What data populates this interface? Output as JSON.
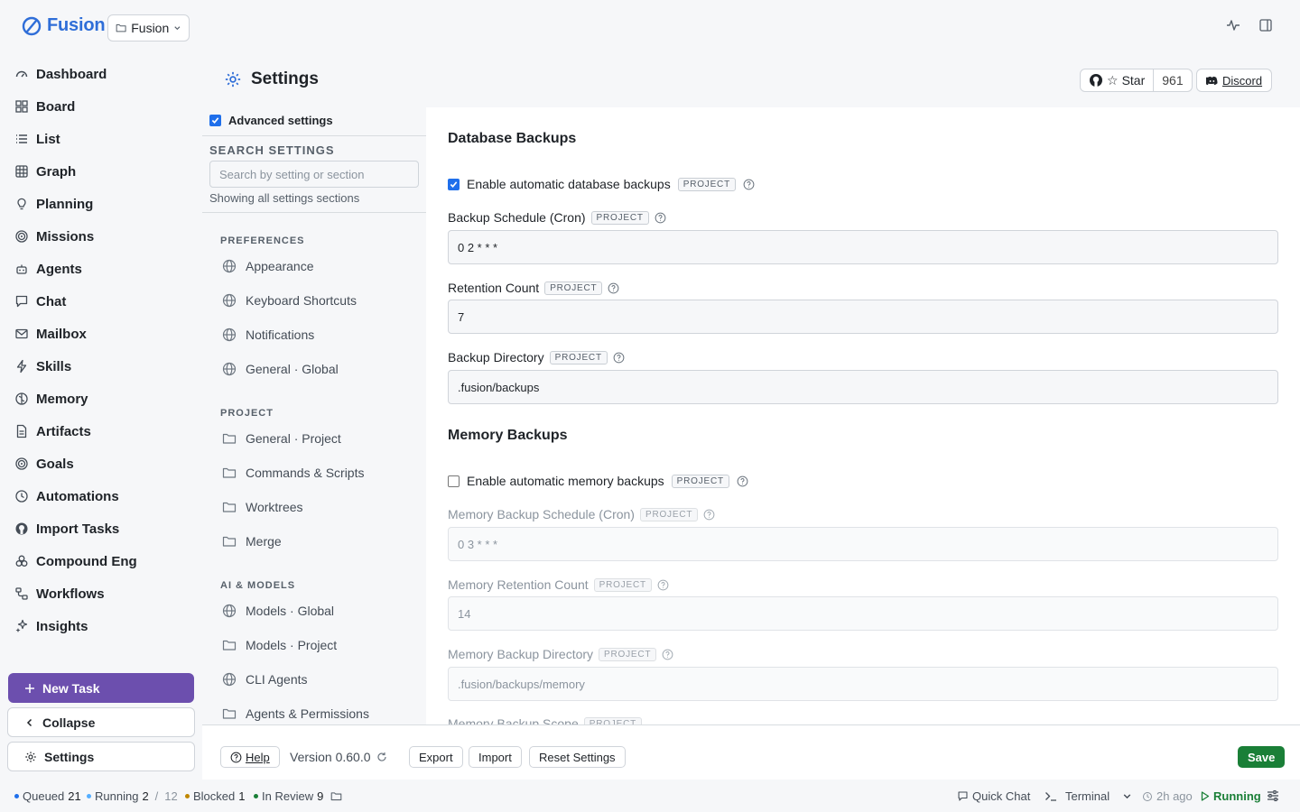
{
  "brand": {
    "name": "Fusion"
  },
  "project_switcher": {
    "label": "Fusion"
  },
  "sidebar": {
    "items": [
      {
        "label": "Dashboard",
        "icon": "gauge-icon"
      },
      {
        "label": "Board",
        "icon": "board-icon"
      },
      {
        "label": "List",
        "icon": "list-icon"
      },
      {
        "label": "Graph",
        "icon": "table-icon"
      },
      {
        "label": "Planning",
        "icon": "lightbulb-icon"
      },
      {
        "label": "Missions",
        "icon": "target-icon"
      },
      {
        "label": "Agents",
        "icon": "bot-icon"
      },
      {
        "label": "Chat",
        "icon": "chat-icon"
      },
      {
        "label": "Mailbox",
        "icon": "mail-icon"
      },
      {
        "label": "Skills",
        "icon": "bolt-icon"
      },
      {
        "label": "Memory",
        "icon": "brain-icon"
      },
      {
        "label": "Artifacts",
        "icon": "file-icon"
      },
      {
        "label": "Goals",
        "icon": "target-icon"
      },
      {
        "label": "Automations",
        "icon": "clock-icon"
      },
      {
        "label": "Import Tasks",
        "icon": "github-icon"
      },
      {
        "label": "Compound Eng",
        "icon": "compound-icon"
      },
      {
        "label": "Workflows",
        "icon": "workflow-icon"
      },
      {
        "label": "Insights",
        "icon": "sparkle-icon"
      }
    ],
    "new_task": "New Task",
    "collapse": "Collapse",
    "settings": "Settings"
  },
  "header": {
    "title": "Settings",
    "github_star": "Star",
    "github_count": "961",
    "discord": "Discord"
  },
  "settings_nav": {
    "advanced_label": "Advanced settings",
    "advanced_checked": true,
    "search_title": "SEARCH SETTINGS",
    "search_placeholder": "Search by setting or section",
    "showing": "Showing all settings sections",
    "sections": [
      {
        "title": "PREFERENCES",
        "items": [
          {
            "label": "Appearance",
            "icon": "globe-icon"
          },
          {
            "label": "Keyboard Shortcuts",
            "icon": "globe-icon"
          },
          {
            "label": "Notifications",
            "icon": "globe-icon"
          },
          {
            "label": "General · Global",
            "icon": "globe-icon"
          }
        ]
      },
      {
        "title": "PROJECT",
        "items": [
          {
            "label": "General · Project",
            "icon": "folder-icon"
          },
          {
            "label": "Commands & Scripts",
            "icon": "folder-icon"
          },
          {
            "label": "Worktrees",
            "icon": "folder-icon"
          },
          {
            "label": "Merge",
            "icon": "folder-icon"
          }
        ]
      },
      {
        "title": "AI & MODELS",
        "items": [
          {
            "label": "Models · Global",
            "icon": "globe-icon"
          },
          {
            "label": "Models · Project",
            "icon": "folder-icon"
          },
          {
            "label": "CLI Agents",
            "icon": "globe-icon"
          },
          {
            "label": "Agents & Permissions",
            "icon": "folder-icon"
          }
        ]
      }
    ]
  },
  "panel": {
    "db_title": "Database Backups",
    "db_enable_label": "Enable automatic database backups",
    "db_enable_checked": true,
    "badge": "PROJECT",
    "db_schedule_label": "Backup Schedule (Cron)",
    "db_schedule_value": "0 2 * * *",
    "db_retention_label": "Retention Count",
    "db_retention_value": "7",
    "db_dir_label": "Backup Directory",
    "db_dir_value": ".fusion/backups",
    "mem_title": "Memory Backups",
    "mem_enable_label": "Enable automatic memory backups",
    "mem_enable_checked": false,
    "mem_schedule_label": "Memory Backup Schedule (Cron)",
    "mem_schedule_value": "0 3 * * *",
    "mem_retention_label": "Memory Retention Count",
    "mem_retention_value": "14",
    "mem_dir_label": "Memory Backup Directory",
    "mem_dir_value": ".fusion/backups/memory",
    "mem_scope_label": "Memory Backup Scope"
  },
  "footer": {
    "help": "Help",
    "version": "Version 0.60.0",
    "export": "Export",
    "import": "Import",
    "reset": "Reset Settings",
    "save": "Save"
  },
  "status_bar": {
    "queued_label": "Queued",
    "queued_count": "21",
    "running_label": "Running",
    "running_count": "2",
    "running_sep": "/",
    "running_total": "12",
    "blocked_label": "Blocked",
    "blocked_count": "1",
    "review_label": "In Review",
    "review_count": "9",
    "quick_chat": "Quick Chat",
    "terminal": "Terminal",
    "last_update": "2h ago",
    "state": "Running"
  },
  "colors": {
    "brand": "#2f6ed8",
    "new_task_bg": "#6c4fae",
    "save_bg": "#1a7f37",
    "queued_dot": "#1f6feb",
    "running_dot": "#54aeff",
    "blocked_dot": "#bf8700",
    "review_dot": "#1a7f37",
    "running_state": "#1a7f37"
  }
}
